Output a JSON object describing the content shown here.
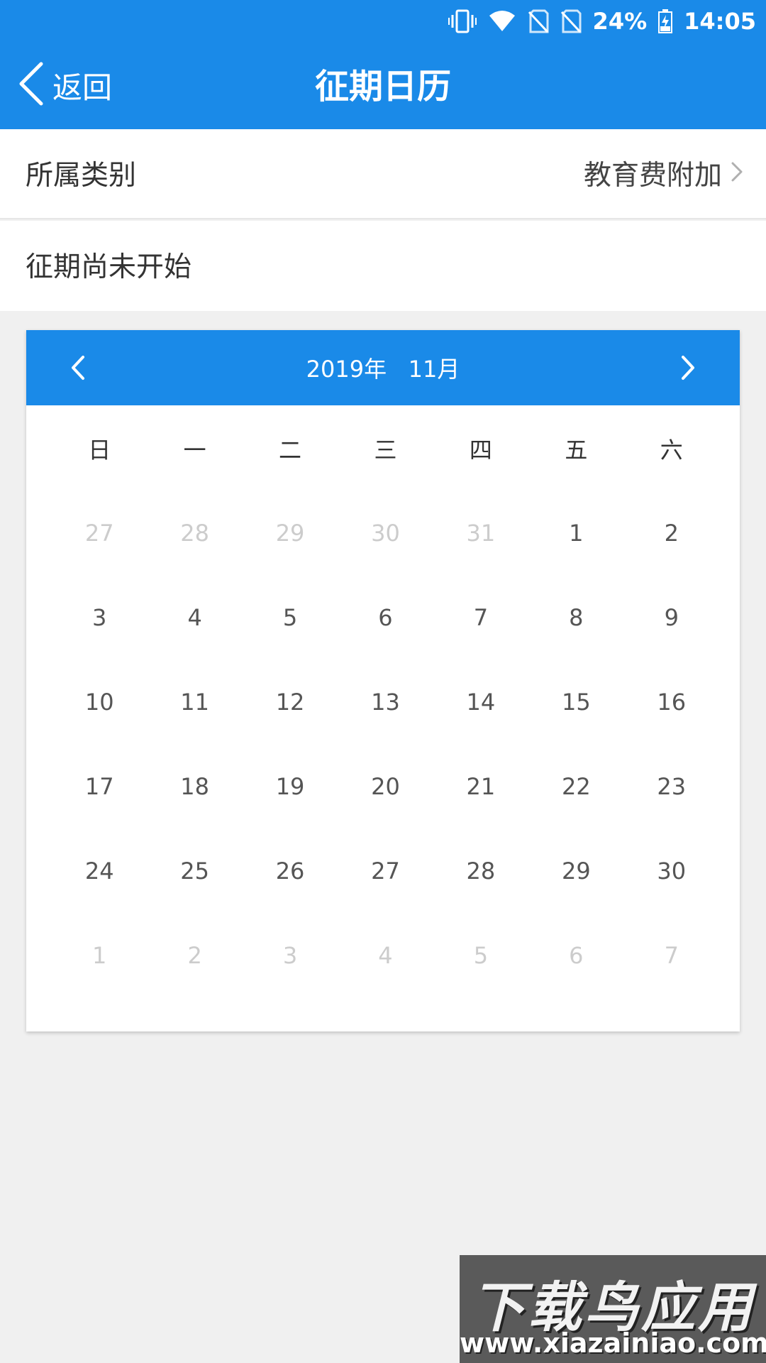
{
  "status_bar": {
    "battery": "24%",
    "time": "14:05",
    "icons": [
      "vibrate-icon",
      "wifi-icon",
      "no-sim-icon",
      "no-sim-icon",
      "battery-charging-icon"
    ]
  },
  "nav": {
    "back_label": "返回",
    "title": "征期日历"
  },
  "category": {
    "label": "所属类别",
    "value": "教育费附加"
  },
  "status_text": "征期尚未开始",
  "calendar": {
    "title": "2019年   11月",
    "weekdays": [
      "日",
      "一",
      "二",
      "三",
      "四",
      "五",
      "六"
    ],
    "weeks": [
      [
        {
          "d": "27",
          "muted": true
        },
        {
          "d": "28",
          "muted": true
        },
        {
          "d": "29",
          "muted": true
        },
        {
          "d": "30",
          "muted": true
        },
        {
          "d": "31",
          "muted": true
        },
        {
          "d": "1",
          "muted": false
        },
        {
          "d": "2",
          "muted": false
        }
      ],
      [
        {
          "d": "3",
          "muted": false
        },
        {
          "d": "4",
          "muted": false
        },
        {
          "d": "5",
          "muted": false
        },
        {
          "d": "6",
          "muted": false
        },
        {
          "d": "7",
          "muted": false
        },
        {
          "d": "8",
          "muted": false
        },
        {
          "d": "9",
          "muted": false
        }
      ],
      [
        {
          "d": "10",
          "muted": false
        },
        {
          "d": "11",
          "muted": false
        },
        {
          "d": "12",
          "muted": false
        },
        {
          "d": "13",
          "muted": false
        },
        {
          "d": "14",
          "muted": false
        },
        {
          "d": "15",
          "muted": false
        },
        {
          "d": "16",
          "muted": false
        }
      ],
      [
        {
          "d": "17",
          "muted": false
        },
        {
          "d": "18",
          "muted": false
        },
        {
          "d": "19",
          "muted": false
        },
        {
          "d": "20",
          "muted": false
        },
        {
          "d": "21",
          "muted": false
        },
        {
          "d": "22",
          "muted": false
        },
        {
          "d": "23",
          "muted": false
        }
      ],
      [
        {
          "d": "24",
          "muted": false
        },
        {
          "d": "25",
          "muted": false
        },
        {
          "d": "26",
          "muted": false
        },
        {
          "d": "27",
          "muted": false
        },
        {
          "d": "28",
          "muted": false
        },
        {
          "d": "29",
          "muted": false
        },
        {
          "d": "30",
          "muted": false
        }
      ],
      [
        {
          "d": "1",
          "muted": true
        },
        {
          "d": "2",
          "muted": true
        },
        {
          "d": "3",
          "muted": true
        },
        {
          "d": "4",
          "muted": true
        },
        {
          "d": "5",
          "muted": true
        },
        {
          "d": "6",
          "muted": true
        },
        {
          "d": "7",
          "muted": true
        }
      ]
    ]
  },
  "watermark": {
    "title": "下载鸟应用",
    "url": "www.xiazainiao.com"
  },
  "colors": {
    "primary": "#1a8ae8",
    "background": "#f0f0f0",
    "muted_day": "#cccccc"
  }
}
